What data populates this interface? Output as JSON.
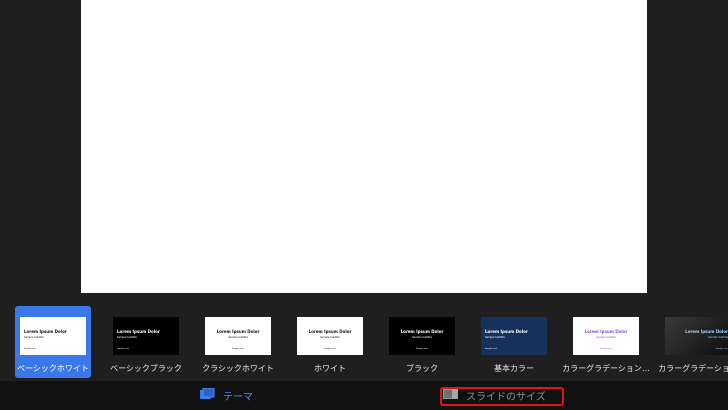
{
  "themes": [
    {
      "label": "ベーシックホワイト",
      "title": "Lorem Ipsum Dolor",
      "subtitle": "Sample Subtitle",
      "footer": "Sample text",
      "bg": "#ffffff",
      "fg": "#111111",
      "style": "left",
      "selected": true
    },
    {
      "label": "ベーシックブラック",
      "title": "Lorem Ipsum Dolor",
      "subtitle": "Sample Subtitle",
      "footer": "Sample text",
      "bg": "#000000",
      "fg": "#ffffff",
      "style": "left",
      "selected": false
    },
    {
      "label": "クラシックホワイト",
      "title": "Lorem Ipsum Dolor",
      "subtitle": "Sample Subtitle",
      "footer": "Sample text",
      "bg": "#ffffff",
      "fg": "#111111",
      "style": "center",
      "selected": false
    },
    {
      "label": "ホワイト",
      "title": "Lorem Ipsum Dolor",
      "subtitle": "Sample Subtitle",
      "footer": "Sample text",
      "bg": "#ffffff",
      "fg": "#111111",
      "style": "center",
      "selected": false
    },
    {
      "label": "ブラック",
      "title": "Lorem Ipsum Dolor",
      "subtitle": "Sample Subtitle",
      "footer": "Sample text",
      "bg": "#000000",
      "fg": "#ffffff",
      "style": "center",
      "selected": false
    },
    {
      "label": "基本カラー",
      "title": "Lorem Ipsum Dolor",
      "subtitle": "Sample Subtitle",
      "footer": "Sample text",
      "bg": "#16325c",
      "fg": "#ffffff",
      "style": "left",
      "selected": false
    },
    {
      "label": "カラーグラデーション…",
      "title": "Lorem Ipsum Dolor",
      "subtitle": "Sample Subtitle",
      "footer": "Sample text",
      "bg": "#ffffff",
      "fg": "#8a4de0",
      "style": "center",
      "selected": false
    },
    {
      "label": "カラーグラデーション",
      "title": "Lorem Ipsum Dolor",
      "subtitle": "Sample Subtitle",
      "footer": "Sample text",
      "bg": "#222222",
      "fg": "#9fd0ff",
      "style": "right",
      "selected": false
    }
  ],
  "tabs": {
    "theme_label": "テーマ",
    "theme_icon": "theme-icon",
    "size_label": "スライドのサイズ",
    "size_icon": "slide-size-icon"
  },
  "colors": {
    "accent": "#3b78e7",
    "tab_active": "#4d8cf5",
    "highlight": "#e01616"
  }
}
